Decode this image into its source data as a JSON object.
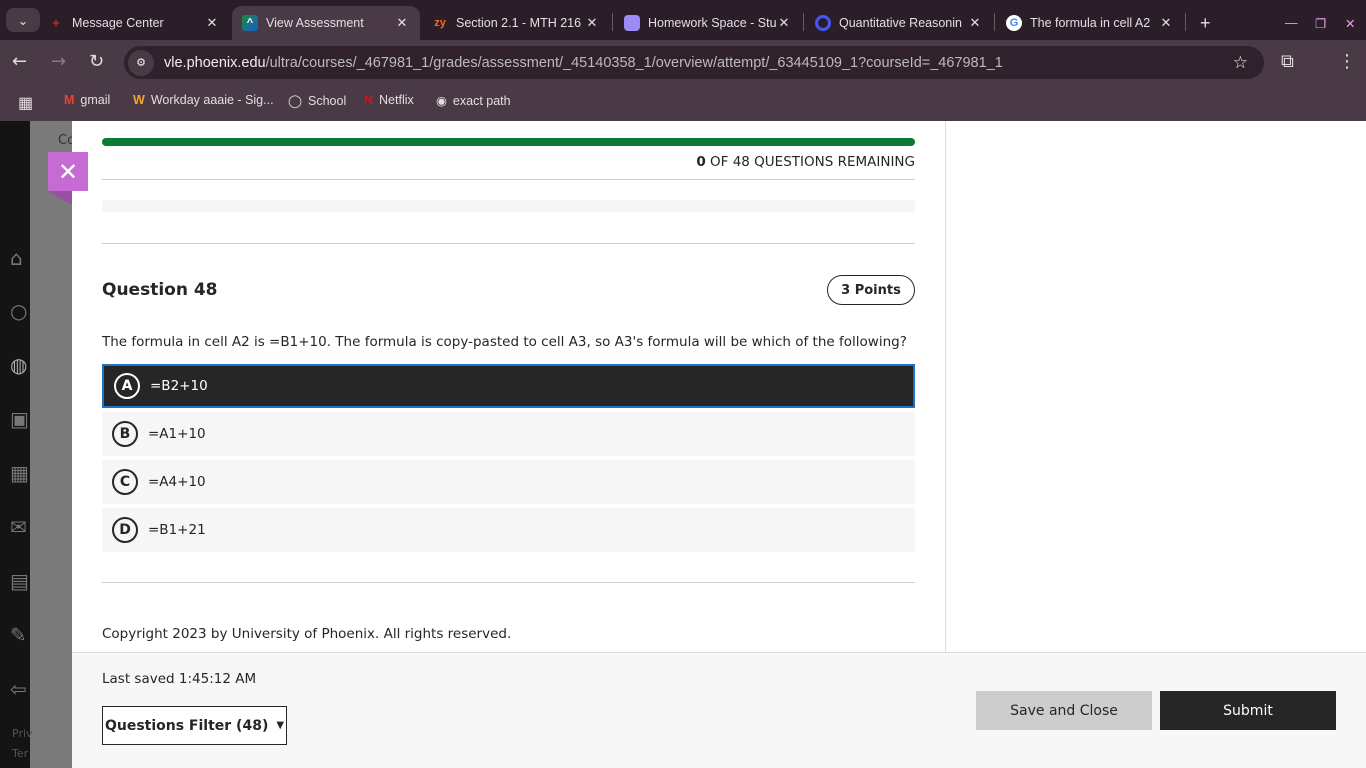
{
  "browser": {
    "tabs": [
      {
        "title": "Message Center",
        "icon": "phoenix-icon",
        "active": false
      },
      {
        "title": "View Assessment",
        "icon": "blackboard-icon",
        "active": true
      },
      {
        "title": "Section 2.1 - MTH 216",
        "icon": "zybooks-icon",
        "active": false
      },
      {
        "title": "Homework Space - Stu",
        "icon": "gem-icon",
        "active": false
      },
      {
        "title": "Quantitative Reasonin",
        "icon": "quizlet-icon",
        "active": false
      },
      {
        "title": "The formula in cell A2",
        "icon": "google-icon",
        "active": false
      }
    ],
    "zy_glyph": "zy",
    "url_domain": "vle.phoenix.edu",
    "url_path": "/ultra/courses/_467981_1/grades/assessment/_45140358_1/overview/attempt/_63445109_1?courseId=_467981_1",
    "bookmarks": [
      {
        "label": "gmail",
        "icon": "gmail-icon"
      },
      {
        "label": "Workday aaaie - Sig...",
        "icon": "workday-icon"
      },
      {
        "label": "School",
        "icon": "bulb-icon"
      },
      {
        "label": "Netflix",
        "icon": "netflix-icon"
      },
      {
        "label": "exact path",
        "icon": "exact-path-icon"
      }
    ]
  },
  "background": {
    "course_fragment": "Co",
    "footer_fragment1": "Priv",
    "footer_fragment2": "Ter"
  },
  "assessment": {
    "progress_percent": 100,
    "remaining_count": "0",
    "remaining_label": " OF 48 QUESTIONS REMAINING",
    "question_title": "Question 48",
    "points": "3 Points",
    "question_text": "The formula in cell A2 is =B1+10. The formula is copy-pasted to cell A3, so A3's formula will be which of the following?",
    "options": [
      {
        "letter": "A",
        "text": "=B2+10",
        "selected": true
      },
      {
        "letter": "B",
        "text": "=A1+10",
        "selected": false
      },
      {
        "letter": "C",
        "text": "=A4+10",
        "selected": false
      },
      {
        "letter": "D",
        "text": "=B1+21",
        "selected": false
      }
    ],
    "copyright": "Copyright 2023 by University of Phoenix. All rights reserved."
  },
  "footer": {
    "last_saved": "Last saved 1:45:12 AM",
    "questions_filter": "Questions Filter (48)",
    "save_close": "Save and Close",
    "submit": "Submit"
  },
  "colors": {
    "accent_close": "#c56bd3",
    "progress": "#0b7a32",
    "selected_border": "#1a73c8"
  }
}
